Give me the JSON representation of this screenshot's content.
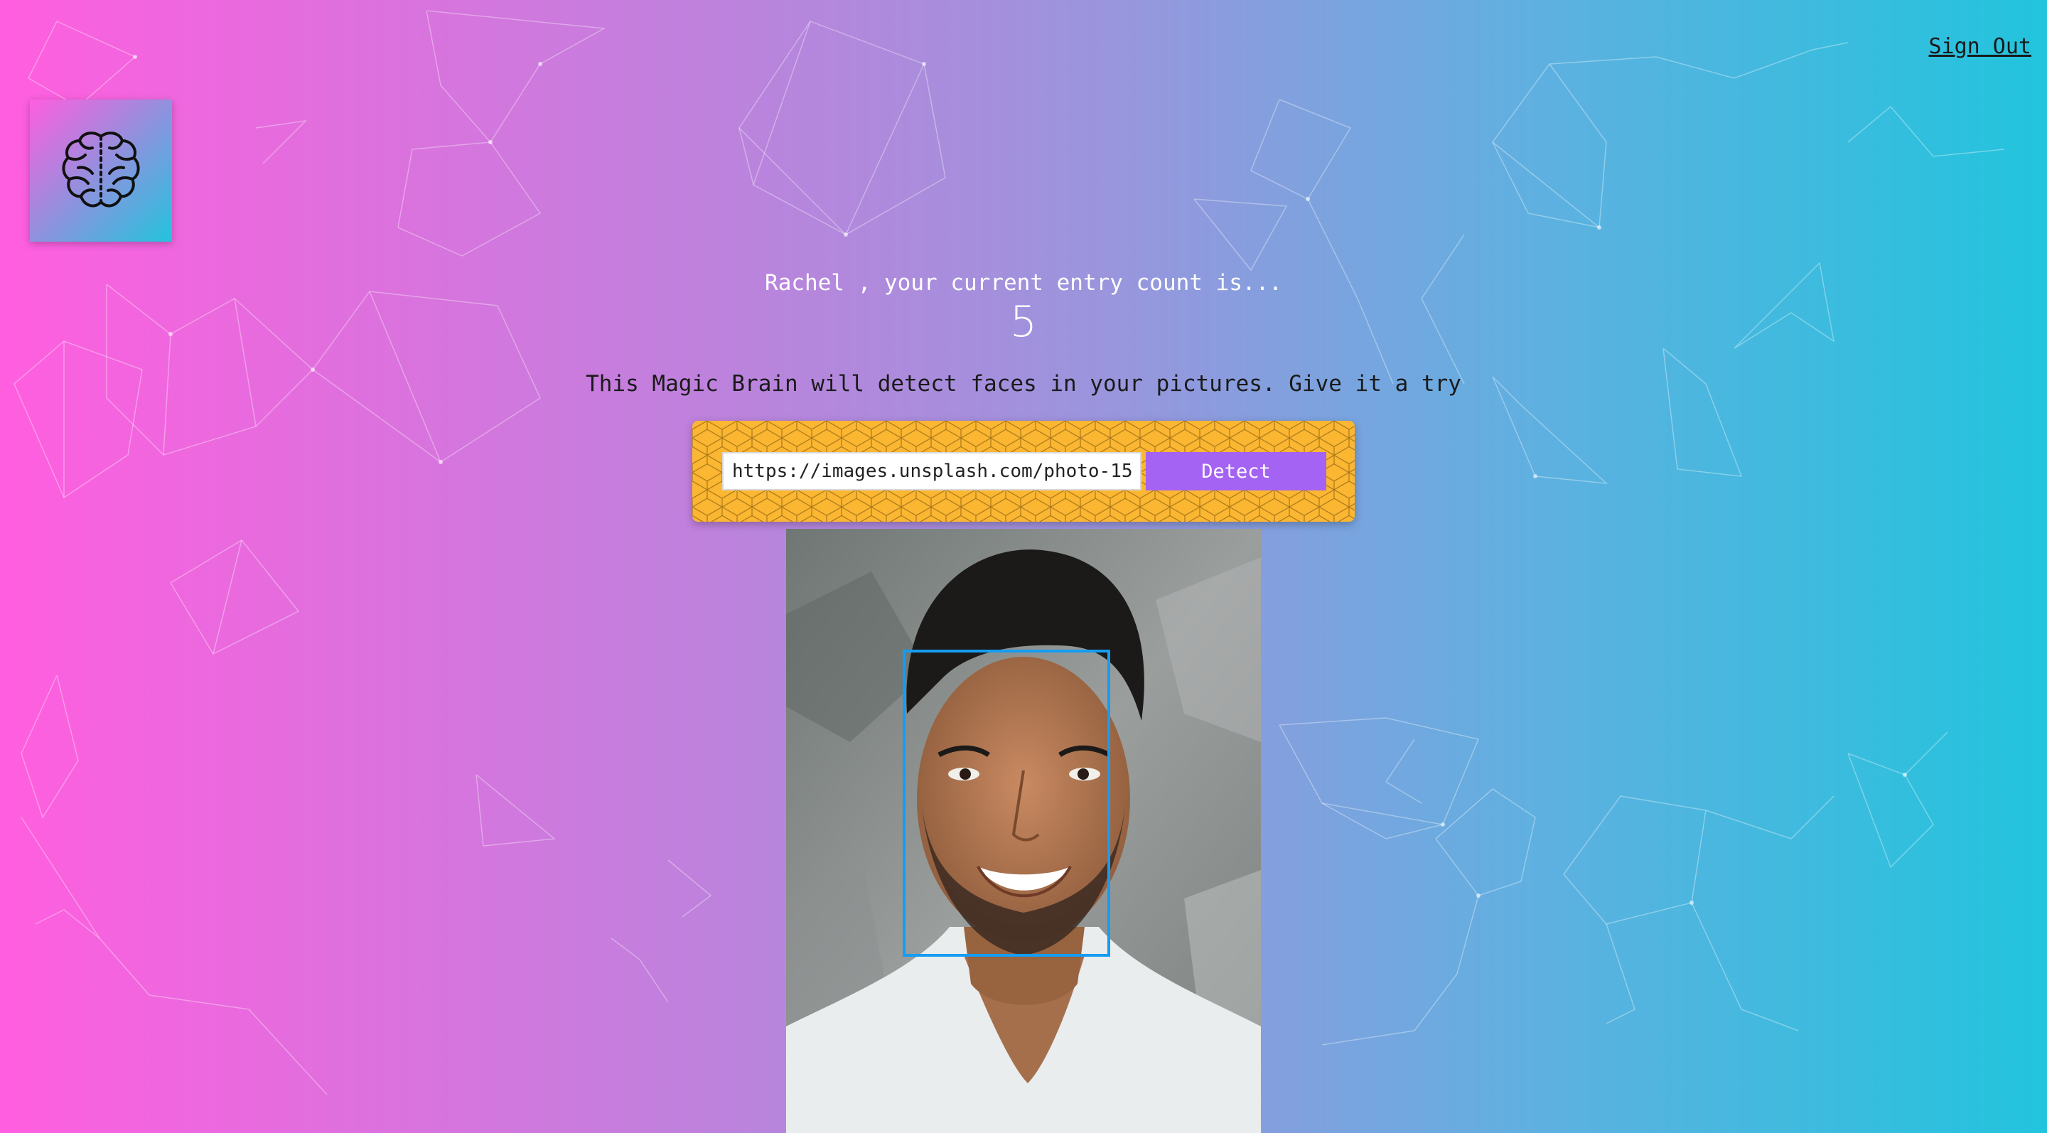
{
  "nav": {
    "sign_out_label": "Sign Out"
  },
  "logo": {
    "icon": "brain-icon"
  },
  "rank": {
    "greeting": "Rachel , your current entry count is...",
    "entries": "5"
  },
  "form": {
    "tagline": "This Magic Brain will detect faces in your pictures. Give it a try",
    "url_value": "https://images.unsplash.com/photo-15",
    "detect_label": "Detect"
  },
  "colors": {
    "gradient_start": "#ff5edf",
    "gradient_end": "#22c4dd",
    "panel": "#fbb632",
    "button": "#a463f2",
    "face_box": "#149df2"
  }
}
